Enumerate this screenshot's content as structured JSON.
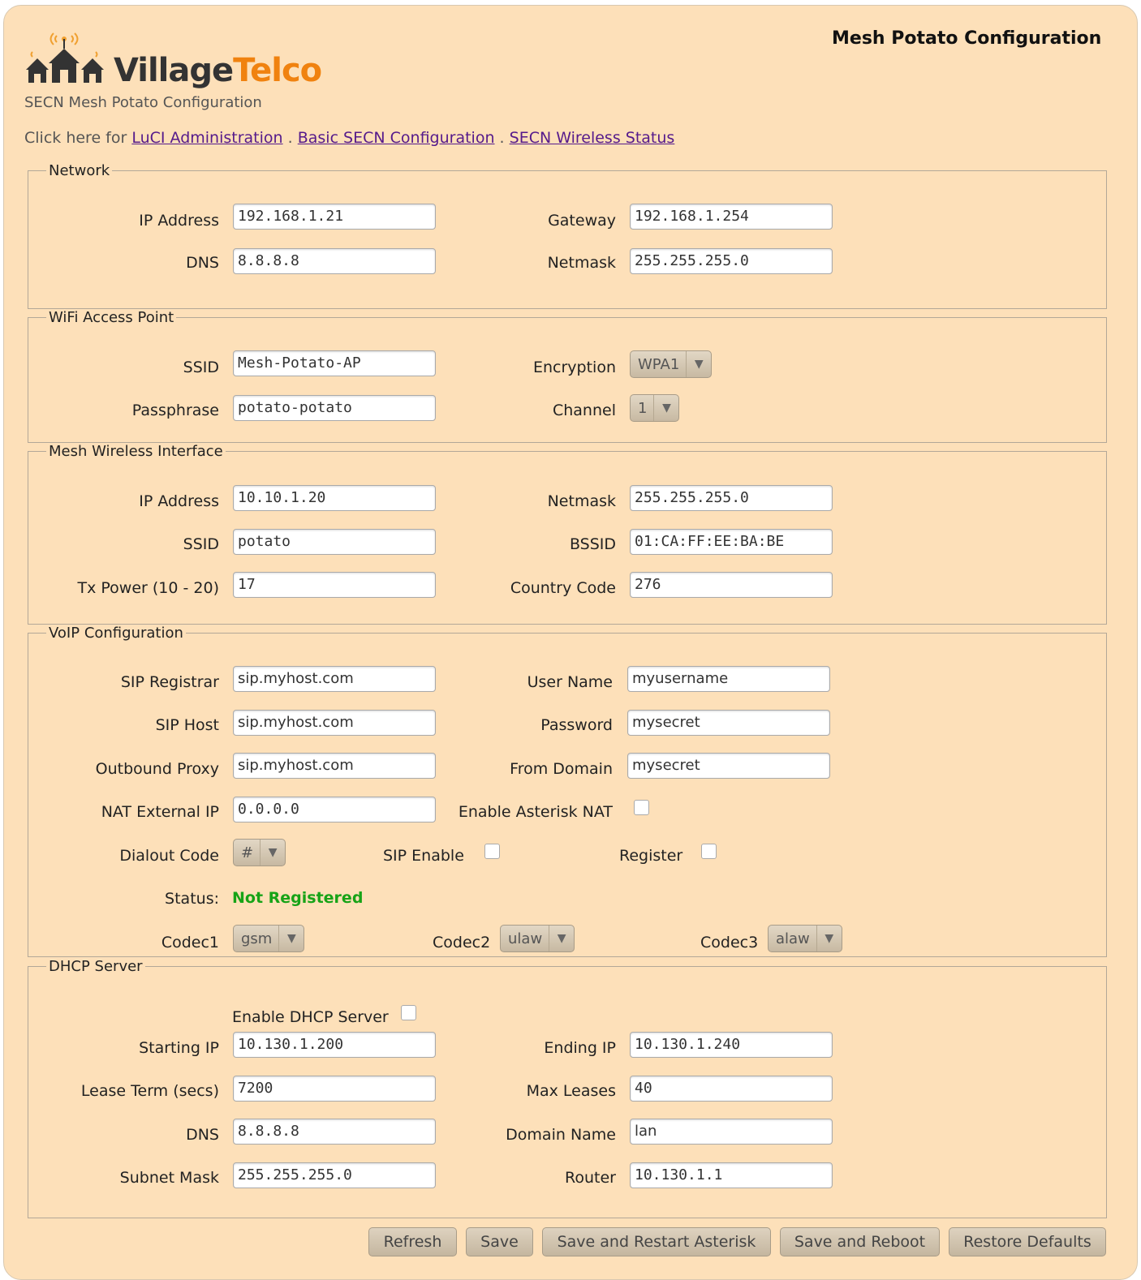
{
  "header": {
    "logo_village": "Village",
    "logo_telco": "Telco",
    "subtitle": "SECN Mesh Potato Configuration",
    "page_title": "Mesh Potato Configuration",
    "nav_prefix": "Click here for",
    "nav_links": [
      "LuCI Administration",
      "Basic SECN Configuration",
      "SECN Wireless Status"
    ],
    "nav_sep": "."
  },
  "network": {
    "legend": "Network",
    "ip_label": "IP Address",
    "ip": "192.168.1.21",
    "gateway_label": "Gateway",
    "gateway": "192.168.1.254",
    "dns_label": "DNS",
    "dns": "8.8.8.8",
    "netmask_label": "Netmask",
    "netmask": "255.255.255.0"
  },
  "wifi": {
    "legend": "WiFi Access Point",
    "ssid_label": "SSID",
    "ssid": "Mesh-Potato-AP",
    "encryption_label": "Encryption",
    "encryption": "WPA1",
    "passphrase_label": "Passphrase",
    "passphrase": "potato-potato",
    "channel_label": "Channel",
    "channel": "1"
  },
  "mesh": {
    "legend": "Mesh Wireless Interface",
    "ip_label": "IP Address",
    "ip": "10.10.1.20",
    "netmask_label": "Netmask",
    "netmask": "255.255.255.0",
    "ssid_label": "SSID",
    "ssid": "potato",
    "bssid_label": "BSSID",
    "bssid": "01:CA:FF:EE:BA:BE",
    "txpower_label": "Tx Power (10 - 20)",
    "txpower": "17",
    "country_label": "Country Code",
    "country": "276"
  },
  "voip": {
    "legend": "VoIP Configuration",
    "registrar_label": "SIP Registrar",
    "registrar": "sip.myhost.com",
    "username_label": "User Name",
    "username": "myusername",
    "siphost_label": "SIP Host",
    "siphost": "sip.myhost.com",
    "password_label": "Password",
    "password": "mysecret",
    "proxy_label": "Outbound Proxy",
    "proxy": "sip.myhost.com",
    "fromdomain_label": "From Domain",
    "fromdomain": "mysecret",
    "natip_label": "NAT External IP",
    "natip": "0.0.0.0",
    "asterisknat_label": "Enable Asterisk NAT",
    "dialout_label": "Dialout Code",
    "dialout": "#",
    "sipenable_label": "SIP Enable",
    "register_label": "Register",
    "status_label": "Status:",
    "status": "Not Registered",
    "codec1_label": "Codec1",
    "codec1": "gsm",
    "codec2_label": "Codec2",
    "codec2": "ulaw",
    "codec3_label": "Codec3",
    "codec3": "alaw"
  },
  "dhcp": {
    "legend": "DHCP Server",
    "enable_label": "Enable DHCP Server",
    "start_label": "Starting IP",
    "start": "10.130.1.200",
    "end_label": "Ending IP",
    "end": "10.130.1.240",
    "lease_label": "Lease Term (secs)",
    "lease": "7200",
    "max_label": "Max Leases",
    "max": "40",
    "dns_label": "DNS",
    "dns": "8.8.8.8",
    "domain_label": "Domain Name",
    "domain": "lan",
    "subnet_label": "Subnet Mask",
    "subnet": "255.255.255.0",
    "router_label": "Router",
    "router": "10.130.1.1"
  },
  "buttons": {
    "refresh": "Refresh",
    "save": "Save",
    "save_restart": "Save and Restart Asterisk",
    "save_reboot": "Save and Reboot",
    "restore": "Restore Defaults"
  },
  "colors": {
    "panel": "#fde0b9",
    "accent": "#f0820f",
    "status_ok": "#17a317",
    "link": "#551a8b"
  }
}
